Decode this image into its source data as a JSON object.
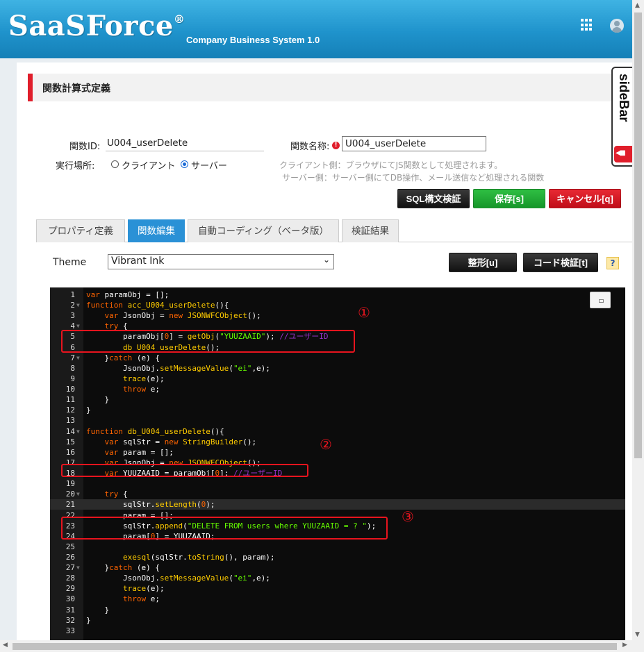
{
  "header": {
    "logo": "SaaSForce",
    "logo_mark": "®",
    "subtitle": "Company Business System 1.0"
  },
  "page": {
    "title": "関数計算式定義",
    "sidebar_tab": "sideBar"
  },
  "form": {
    "function_id_label": "関数ID:",
    "function_id_value": "U004_userDelete",
    "function_name_label": "関数名称:",
    "function_name_value": "U004_userDelete",
    "exec_location_label": "実行場所:",
    "radio_client": "クライアント",
    "radio_server": "サーバー",
    "selected_location": "サーバー",
    "note_client": "クライアント側：ブラウザにてJS関数として処理されます。",
    "note_server": "サーバー側：サーバー側にてDB操作、メール送信など処理される関数"
  },
  "buttons": {
    "sql_validate": "SQL構文検証",
    "save": "保存[s]",
    "cancel": "キャンセル[q]",
    "format": "整形[u]",
    "code_validate": "コード検証[t]",
    "help": "?"
  },
  "tabs": [
    {
      "label": "プロパティ定義",
      "active": false
    },
    {
      "label": "関数編集",
      "active": true
    },
    {
      "label": "自動コーディング（ベータ版）",
      "active": false
    },
    {
      "label": "検証結果",
      "active": false
    }
  ],
  "theme": {
    "label": "Theme",
    "selected": "Vibrant Ink"
  },
  "annotations": [
    "①",
    "②",
    "③"
  ],
  "colors": {
    "header": "#1f93cc",
    "accent_red": "#e01e2b",
    "active_tab": "#2a91d6",
    "save_green": "#16962a",
    "editor_bg": "#0c0c0c"
  },
  "code_lines": [
    "var paramObj = [];",
    "function acc_U004_userDelete(){",
    "    var JsonObj = new JSONWFCObject();",
    "    try {",
    "        paramObj[0] = getObj(\"YUUZAAID\"); //ユーザーID",
    "        db_U004_userDelete();",
    "    }catch (e) {",
    "        JsonObj.setMessageValue(\"ei\",e);",
    "        trace(e);",
    "        throw e;",
    "    }",
    "}",
    "",
    "function db_U004_userDelete(){",
    "    var sqlStr = new StringBuilder();",
    "    var param = [];",
    "    var JsonObj = new JSONWFCObject();",
    "    var YUUZAAID = paramObj[0]; //ユーザーID",
    "",
    "    try {",
    "        sqlStr.setLength(0);",
    "        param = [];",
    "        sqlStr.append(\"DELETE FROM users where YUUZAAID = ? \");",
    "        param[0] = YUUZAAID;",
    "",
    "        exesql(sqlStr.toString(), param);",
    "    }catch (e) {",
    "        JsonObj.setMessageValue(\"ei\",e);",
    "        trace(e);",
    "        throw e;",
    "    }",
    "}",
    ""
  ]
}
